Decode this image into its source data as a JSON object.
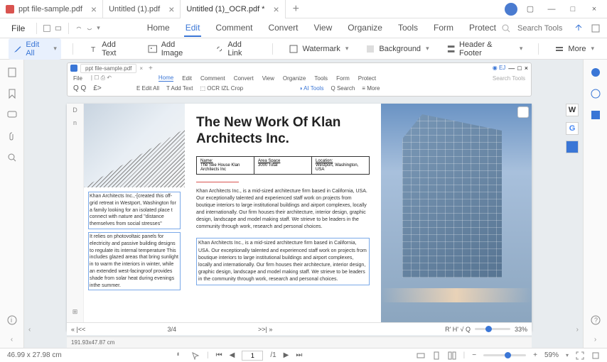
{
  "titlebar": {
    "tabs": [
      {
        "label": "ppt file-sample.pdf"
      },
      {
        "label": "Untitled (1).pdf"
      },
      {
        "label": "Untitled (1)_OCR.pdf *"
      }
    ]
  },
  "menubar": {
    "file": "File",
    "tabs": [
      "Home",
      "Edit",
      "Comment",
      "Convert",
      "View",
      "Organize",
      "Tools",
      "Form",
      "Protect"
    ],
    "active": "Edit",
    "search_placeholder": "Search Tools"
  },
  "toolbar": {
    "edit_all": "Edit All",
    "add_text": "Add Text",
    "add_image": "Add Image",
    "add_link": "Add Link",
    "watermark": "Watermark",
    "background": "Background",
    "header_footer": "Header & Footer",
    "more": "More"
  },
  "nested": {
    "tab_label": "ppt file-sample.pdf",
    "file": "File",
    "menus": [
      "Home",
      "Edit",
      "Comment",
      "Convert",
      "View",
      "Organize",
      "Tools",
      "Form",
      "Protect"
    ],
    "menu_active": "Home",
    "search": "Search Tools",
    "tool_edit": "E Edit All",
    "tool_add_text": "Add Text",
    "tool_ocr": "OCR IZL Crop",
    "tool_ai": "AI Tools",
    "tool_search": "Search",
    "tool_more": "More",
    "page_nav": "3/4",
    "nav_prev": "« |<<",
    "nav_next": ">>| »",
    "zoom_label": "33%",
    "controls": "R' H' √ Q",
    "coords": "191.93x47.87 cm"
  },
  "doc": {
    "thumb_top": "D",
    "thumb_bot": "n",
    "title": "The New Work Of Klan Architects Inc.",
    "table": {
      "c1h": "Name:",
      "c1v": "The See House Klan Architects Inc",
      "c2h": "Area Space",
      "c2v": "3000 Total",
      "c3h": "Location:",
      "c3v": "Westport, Washington, USA"
    },
    "left_p1": "Khan Architects Inc.,-[created this off-grid retreat in Westport, Washington for a family looking for an isolated place t connect with nature and \"distance themselves from social stresses\"",
    "left_p2": "It relies on photovoltaic panels for electricity and passive building designs to regulate its internal temperature This includes glazed areas that bring sunlight in to warm the interiors in winter, while an extended west-facingroof provides shade from solar heat during evenings inthe summer.",
    "para": "Khan Architects Inc., is a mid-sized architecture firm based in California, USA. Our exceptionally talented and experienced staff work on projects from boutique interiors to large institutional buildings and airport complexes, locally and internationally. Our firm houses their architecture, interior design, graphic design, landscape and model making staff. We strieve to be leaders in the community through work, research and personal choices.",
    "float_letters": [
      "W",
      "G"
    ]
  },
  "statusbar": {
    "dims": "46.99 x 27.98 cm",
    "page_current": "1",
    "page_total": "/1",
    "zoom": "59%"
  }
}
